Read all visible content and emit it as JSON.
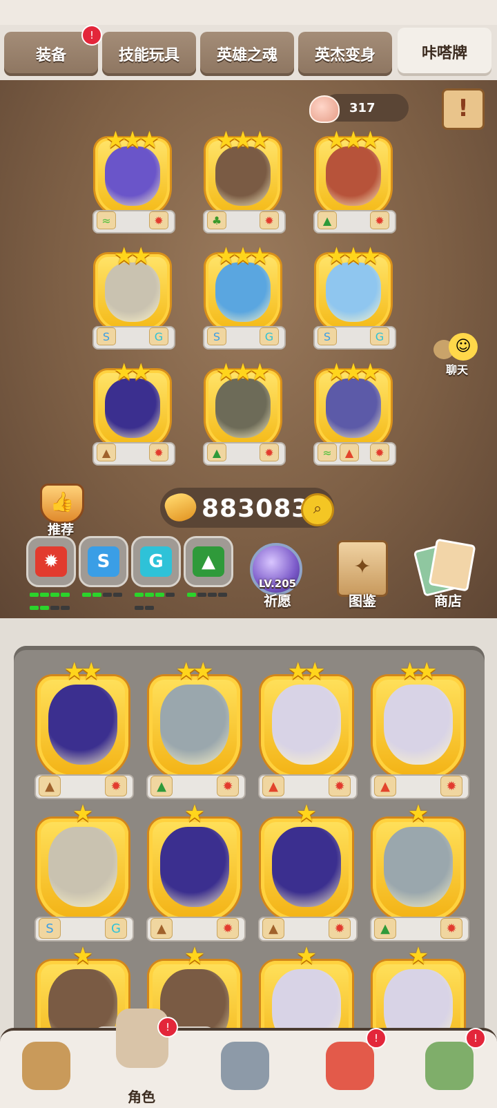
{
  "tabs": [
    {
      "label": "装备",
      "active": false,
      "badge": true
    },
    {
      "label": "技能玩具",
      "active": false,
      "badge": false
    },
    {
      "label": "英雄之魂",
      "active": false,
      "badge": false
    },
    {
      "label": "英杰变身",
      "active": false,
      "badge": false
    },
    {
      "label": "咔嗒牌",
      "active": true,
      "badge": false
    }
  ],
  "badge_glyph": "!",
  "shell_count": "317",
  "notice_glyph": "!",
  "chat_label": "聊天",
  "recommend_label": "推荐",
  "bone_count": "883083",
  "search_glyph": "🔍",
  "pray": {
    "level": "LV.205",
    "label": "祈愿"
  },
  "atlas_label": "图鉴",
  "shop_label": "商店",
  "elements": [
    {
      "icon": "fire-element-icon",
      "color": "#e23b2e",
      "glyph": "✹",
      "bars_on": 6,
      "bars_total": 9
    },
    {
      "icon": "water-element-icon",
      "color": "#3a9ee6",
      "glyph": "S",
      "bars_on": 2,
      "bars_total": 4
    },
    {
      "icon": "wind-element-icon",
      "color": "#2ec2d8",
      "glyph": "G",
      "bars_on": 3,
      "bars_total": 6
    },
    {
      "icon": "tree-element-icon",
      "color": "#2f9a3a",
      "glyph": "▲",
      "bars_on": 1,
      "bars_total": 4
    }
  ],
  "deck": [
    {
      "stars": 3,
      "body": "#6a55c9",
      "left": "grass-element-icon",
      "right": "fire-element-icon"
    },
    {
      "stars": 3,
      "body": "#7a5b44",
      "left": "palm-element-icon",
      "right": "fire-element-icon"
    },
    {
      "stars": 3,
      "body": "#b7533a",
      "left": "tree-element-icon",
      "right": "fire-element-icon"
    },
    {
      "stars": 2,
      "body": "#c9c2b0",
      "left": "water-element-icon",
      "right": "wind-element-icon"
    },
    {
      "stars": 3,
      "body": "#5aa6e0",
      "left": "water-element-icon",
      "right": "wind-element-icon"
    },
    {
      "stars": 3,
      "body": "#8fc6ef",
      "left": "water-element-icon",
      "right": "wind-element-icon"
    },
    {
      "stars": 2,
      "body": "#3b2f8f",
      "left": "mountain-element-icon",
      "right": "fire-element-icon"
    },
    {
      "stars": 3,
      "body": "#6d6b58",
      "left": "tree-element-icon",
      "right": "fire-element-icon"
    },
    {
      "stars": 3,
      "body": "#5c5aa8",
      "left": "grass-element-icon",
      "left2": "volcano-element-icon",
      "right": "fire-element-icon"
    }
  ],
  "collection": [
    {
      "stars": 2,
      "body": "#3b2f8f",
      "left": "mountain-element-icon",
      "right": "fire-element-icon"
    },
    {
      "stars": 2,
      "body": "#9aa7ad",
      "left": "tree-element-icon",
      "right": "fire-element-icon"
    },
    {
      "stars": 2,
      "body": "#d8d3e6",
      "left": "volcano-element-icon",
      "right": "fire-element-icon"
    },
    {
      "stars": 2,
      "body": "#d8d3e6",
      "left": "volcano-element-icon",
      "right": "fire-element-icon"
    },
    {
      "stars": 1,
      "body": "#c9c2b0",
      "left": "water-element-icon",
      "right": "wind-element-icon"
    },
    {
      "stars": 1,
      "body": "#3b2f8f",
      "left": "mountain-element-icon",
      "right": "fire-element-icon"
    },
    {
      "stars": 1,
      "body": "#3b2f8f",
      "left": "mountain-element-icon",
      "right": "fire-element-icon"
    },
    {
      "stars": 1,
      "body": "#9aa7ad",
      "left": "tree-element-icon",
      "right": "fire-element-icon"
    },
    {
      "stars": 1,
      "body": "#7a5b44",
      "left": "",
      "right": ""
    },
    {
      "stars": 1,
      "body": "#7a5b44",
      "left": "",
      "right": ""
    },
    {
      "stars": 1,
      "body": "#d8d3e6",
      "left": "",
      "right": ""
    },
    {
      "stars": 1,
      "body": "#d8d3e6",
      "left": "",
      "right": ""
    }
  ],
  "nav": [
    {
      "icon": "caveman-icon",
      "label": "",
      "badge": false,
      "selected": false
    },
    {
      "icon": "character-icon",
      "label": "角色",
      "badge": true,
      "selected": true
    },
    {
      "icon": "weapon-icon",
      "label": "",
      "badge": false,
      "selected": false
    },
    {
      "icon": "pet-icon",
      "label": "",
      "badge": true,
      "selected": false
    },
    {
      "icon": "totem-icon",
      "label": "",
      "badge": true,
      "selected": false
    }
  ],
  "colors": {
    "star": "#ffd51c",
    "gold_frame": "#f4b916",
    "badge": "#e3263a",
    "bg_brown": "#7d5f45"
  }
}
